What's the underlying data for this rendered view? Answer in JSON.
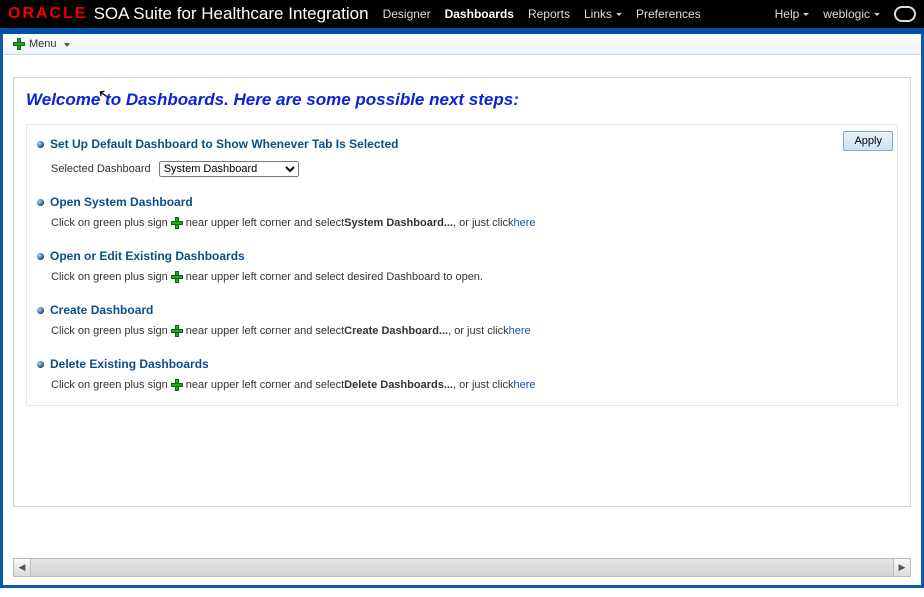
{
  "topbar": {
    "brand": "ORACLE",
    "product": "SOA Suite for Healthcare Integration",
    "nav": {
      "designer": "Designer",
      "dashboards": "Dashboards",
      "reports": "Reports",
      "links": "Links",
      "preferences": "Preferences",
      "help": "Help",
      "user": "weblogic"
    }
  },
  "menu": {
    "label": "Menu"
  },
  "welcome": {
    "heading": "Welcome to Dashboards.  Here are some possible next steps:",
    "apply": "Apply",
    "sections": {
      "setDefault": {
        "title": "Set Up Default Dashboard to Show Whenever Tab Is Selected",
        "label": "Selected Dashboard",
        "selected": "System Dashboard"
      },
      "openSystem": {
        "title": "Open System Dashboard",
        "pre": "Click on green plus sign ",
        "mid": " near upper left corner and select ",
        "bold": "System Dashboard...",
        "post": ", or just click ",
        "link": "here"
      },
      "openEdit": {
        "title": "Open or Edit Existing Dashboards",
        "pre": "Click on green plus sign ",
        "post": " near upper left corner and select desired Dashboard to open."
      },
      "create": {
        "title": "Create Dashboard",
        "pre": "Click on green plus sign ",
        "mid": " near upper left corner and select ",
        "bold": "Create Dashboard...",
        "post": ", or just click ",
        "link": "here"
      },
      "delete": {
        "title": "Delete Existing Dashboards",
        "pre": "Click on green plus sign ",
        "mid": " near upper left corner and select ",
        "bold": "Delete Dashboards...",
        "post": ", or just click ",
        "link": "here"
      }
    }
  }
}
